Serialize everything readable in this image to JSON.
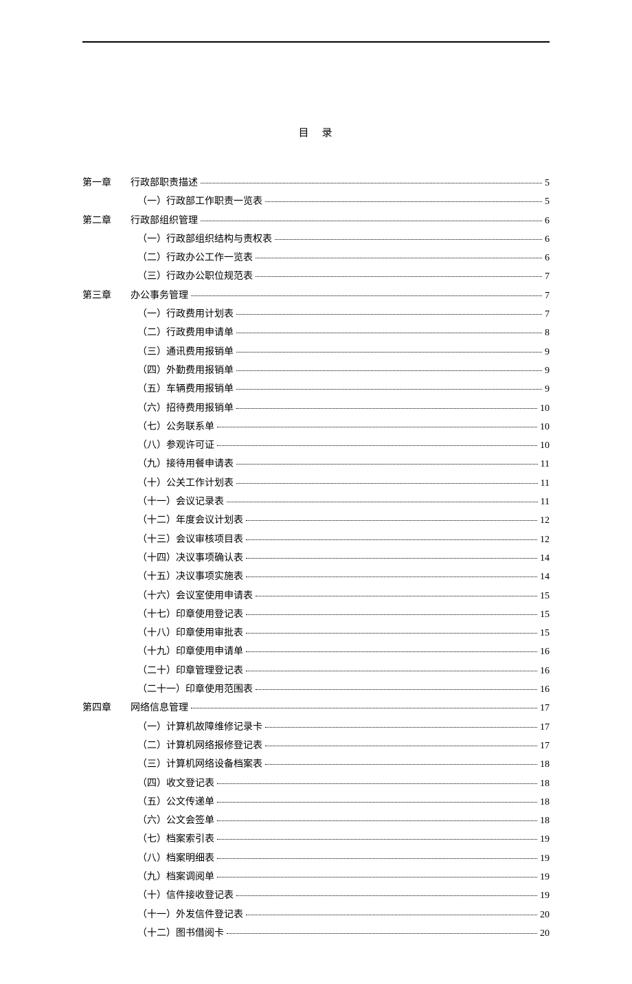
{
  "title": "目　录",
  "toc": [
    {
      "chapter": "第一章",
      "label": "行政部职责描述",
      "page": "5",
      "sub": false
    },
    {
      "chapter": "",
      "label": "（一）行政部工作职责一览表",
      "page": "5",
      "sub": true
    },
    {
      "chapter": "第二章",
      "label": "行政部组织管理",
      "page": "6",
      "sub": false
    },
    {
      "chapter": "",
      "label": "（一）行政部组织结构与责权表",
      "page": "6",
      "sub": true
    },
    {
      "chapter": "",
      "label": "（二）行政办公工作一览表",
      "page": "6",
      "sub": true
    },
    {
      "chapter": "",
      "label": "（三）行政办公职位规范表",
      "page": "7",
      "sub": true
    },
    {
      "chapter": "第三章",
      "label": "办公事务管理",
      "page": "7",
      "sub": false
    },
    {
      "chapter": "",
      "label": "（一）行政费用计划表",
      "page": "7",
      "sub": true
    },
    {
      "chapter": "",
      "label": "（二）行政费用申请单",
      "page": "8",
      "sub": true
    },
    {
      "chapter": "",
      "label": "（三）通讯费用报销单",
      "page": "9",
      "sub": true
    },
    {
      "chapter": "",
      "label": "（四）外勤费用报销单",
      "page": "9",
      "sub": true
    },
    {
      "chapter": "",
      "label": "（五）车辆费用报销单",
      "page": "9",
      "sub": true
    },
    {
      "chapter": "",
      "label": "（六）招待费用报销单",
      "page": "10",
      "sub": true
    },
    {
      "chapter": "",
      "label": "（七）公务联系单",
      "page": "10",
      "sub": true
    },
    {
      "chapter": "",
      "label": "（八）参观许可证",
      "page": "10",
      "sub": true
    },
    {
      "chapter": "",
      "label": "（九）接待用餐申请表",
      "page": "11",
      "sub": true
    },
    {
      "chapter": "",
      "label": "（十）公关工作计划表",
      "page": "11",
      "sub": true
    },
    {
      "chapter": "",
      "label": "（十一）会议记录表",
      "page": "11",
      "sub": true
    },
    {
      "chapter": "",
      "label": "（十二）年度会议计划表",
      "page": "12",
      "sub": true
    },
    {
      "chapter": "",
      "label": "（十三）会议审核项目表",
      "page": "12",
      "sub": true
    },
    {
      "chapter": "",
      "label": "（十四）决议事项确认表",
      "page": "14",
      "sub": true
    },
    {
      "chapter": "",
      "label": "（十五）决议事项实施表",
      "page": "14",
      "sub": true
    },
    {
      "chapter": "",
      "label": "（十六）会议室使用申请表",
      "page": "15",
      "sub": true
    },
    {
      "chapter": "",
      "label": "（十七）印章使用登记表",
      "page": "15",
      "sub": true
    },
    {
      "chapter": "",
      "label": "（十八）印章使用审批表",
      "page": "15",
      "sub": true
    },
    {
      "chapter": "",
      "label": "（十九）印章使用申请单",
      "page": "16",
      "sub": true
    },
    {
      "chapter": "",
      "label": "（二十）印章管理登记表",
      "page": "16",
      "sub": true
    },
    {
      "chapter": "",
      "label": "（二十一）印章使用范围表",
      "page": "16",
      "sub": true
    },
    {
      "chapter": "第四章",
      "label": "网络信息管理",
      "page": "17",
      "sub": false
    },
    {
      "chapter": "",
      "label": "（一）计算机故障维修记录卡",
      "page": "17",
      "sub": true
    },
    {
      "chapter": "",
      "label": "（二）计算机网络报修登记表",
      "page": "17",
      "sub": true
    },
    {
      "chapter": "",
      "label": "（三）计算机网络设备档案表",
      "page": "18",
      "sub": true
    },
    {
      "chapter": "",
      "label": "（四）收文登记表",
      "page": "18",
      "sub": true
    },
    {
      "chapter": "",
      "label": "（五）公文传递单",
      "page": "18",
      "sub": true
    },
    {
      "chapter": "",
      "label": "（六）公文会签单",
      "page": "18",
      "sub": true
    },
    {
      "chapter": "",
      "label": "（七）档案索引表",
      "page": "19",
      "sub": true
    },
    {
      "chapter": "",
      "label": "（八）档案明细表",
      "page": "19",
      "sub": true
    },
    {
      "chapter": "",
      "label": "（九）档案调阅单",
      "page": "19",
      "sub": true
    },
    {
      "chapter": "",
      "label": "（十）信件接收登记表",
      "page": "19",
      "sub": true
    },
    {
      "chapter": "",
      "label": "（十一）外发信件登记表",
      "page": "20",
      "sub": true
    },
    {
      "chapter": "",
      "label": "（十二）图书借阅卡",
      "page": "20",
      "sub": true
    }
  ]
}
